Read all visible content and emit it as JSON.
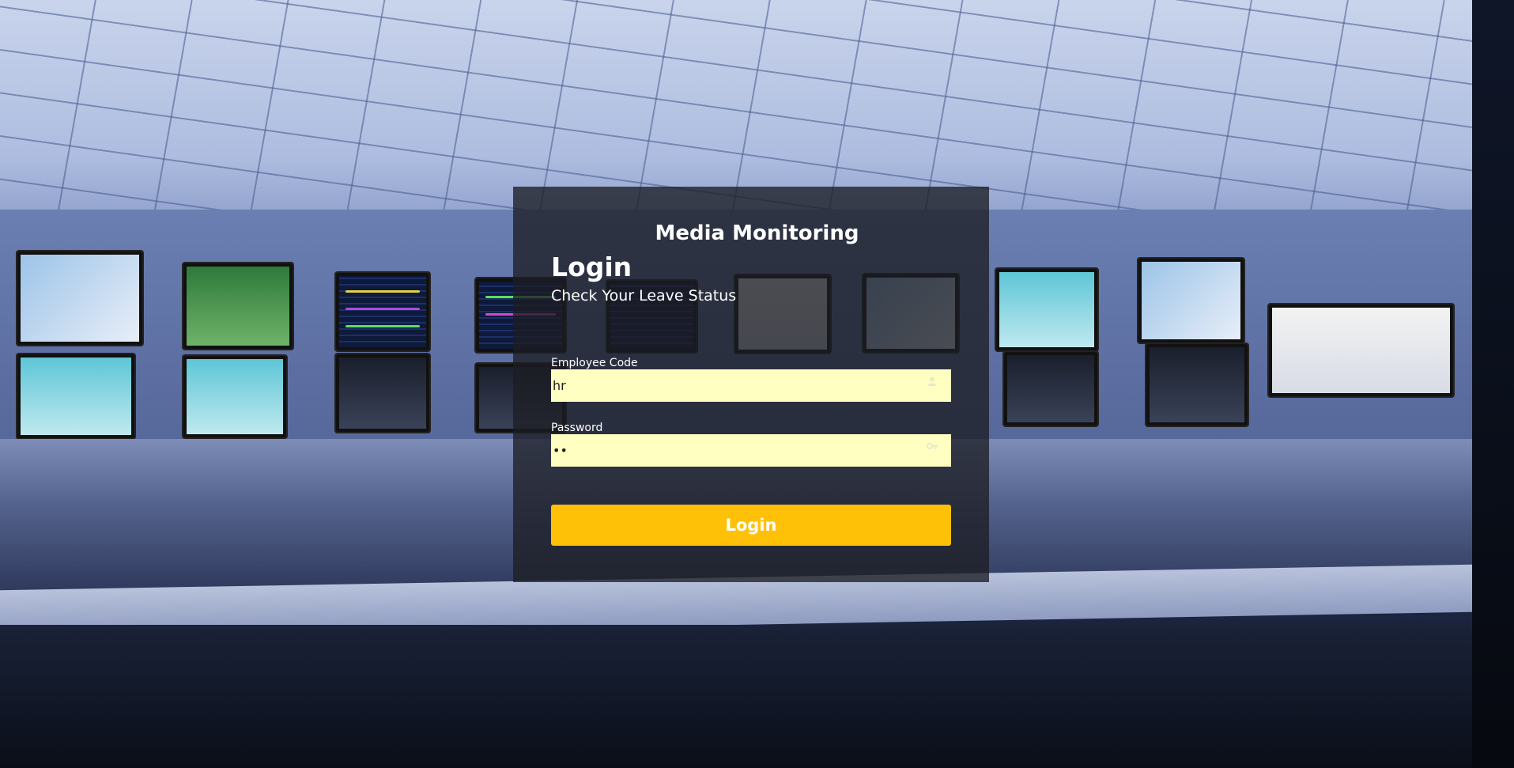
{
  "app": {
    "title": "Media Monitoring"
  },
  "login": {
    "heading": "Login",
    "subheading": "Check Your Leave Status",
    "employee_code": {
      "label": "Employee Code",
      "value": "hr"
    },
    "password": {
      "label": "Password",
      "value": "••"
    },
    "submit_label": "Login"
  },
  "colors": {
    "accent": "#ffc107",
    "field_bg": "#feffc0",
    "panel_bg": "#1c1e24"
  },
  "icons": {
    "employee_code": "person-icon",
    "password": "key-icon"
  }
}
